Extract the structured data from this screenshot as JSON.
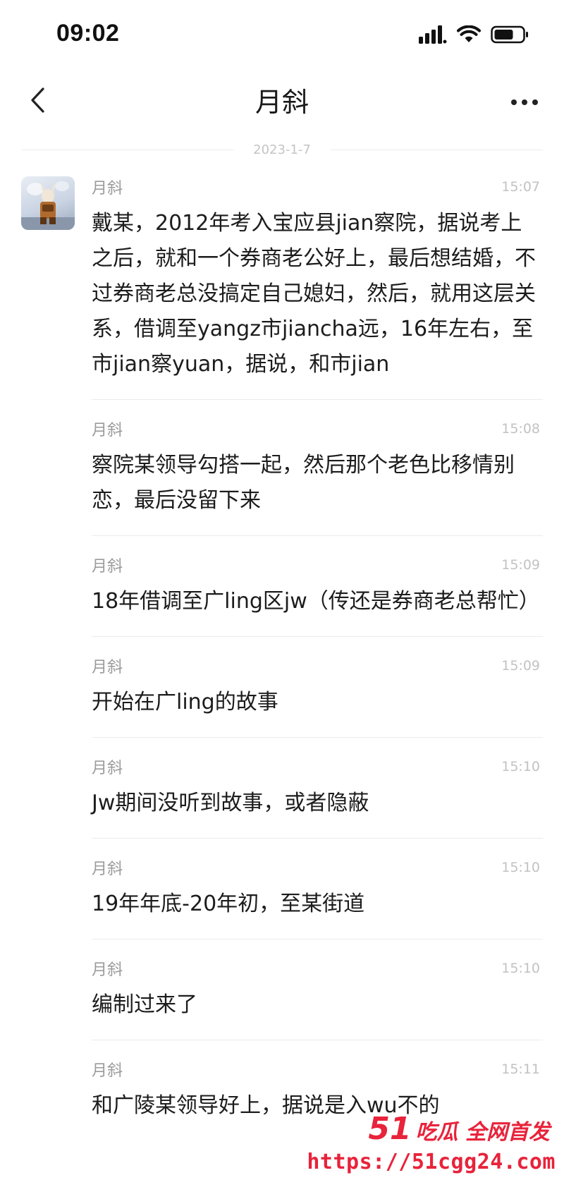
{
  "status_bar": {
    "time": "09:02",
    "icons": [
      "signal-icon",
      "wifi-icon",
      "battery-icon"
    ]
  },
  "nav": {
    "title": "月斜",
    "back_icon": "chevron-left-icon",
    "more_icon": "more-dots-icon"
  },
  "date_divider": "2023-1-7",
  "messages": [
    {
      "sender": "月斜",
      "time": "15:07",
      "text": "戴某，2012年考入宝应县jian察院，据说考上之后，就和一个券商老公好上，最后想结婚，不过券商老总没搞定自己媳妇，然后，就用这层关系，借调至yangz市jiancha远，16年左右，至市jian察yuan，据说，和市jian"
    },
    {
      "sender": "月斜",
      "time": "15:08",
      "text": "察院某领导勾搭一起，然后那个老色比移情别恋，最后没留下来"
    },
    {
      "sender": "月斜",
      "time": "15:09",
      "text": "18年借调至广ling区jw（传还是券商老总帮忙）"
    },
    {
      "sender": "月斜",
      "time": "15:09",
      "text": "开始在广ling的故事"
    },
    {
      "sender": "月斜",
      "time": "15:10",
      "text": "Jw期间没听到故事，或者隐蔽"
    },
    {
      "sender": "月斜",
      "time": "15:10",
      "text": "19年年底-20年初，至某街道"
    },
    {
      "sender": "月斜",
      "time": "15:10",
      "text": "编制过来了"
    },
    {
      "sender": "月斜",
      "time": "15:11",
      "text": "和广陵某领导好上，据说是入wu不的"
    }
  ],
  "watermark": {
    "brand_number": "51",
    "brand_text": "吃瓜 全网首发",
    "url": "https://51cgg24.com",
    "color": "#e8233b"
  }
}
